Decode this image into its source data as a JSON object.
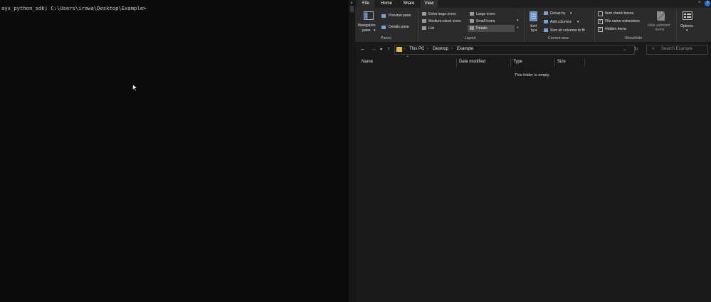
{
  "terminal": {
    "prompt": "ayx_python_sdk) C:\\Users\\irawa\\Desktop\\Example>"
  },
  "explorer": {
    "tabs": {
      "file": "File",
      "home": "Home",
      "share": "Share",
      "view": "View"
    },
    "ribbon": {
      "panes": {
        "navigation_pane": [
          "Navigation",
          "pane"
        ],
        "preview_pane": "Preview pane",
        "details_pane": "Details pane",
        "group_label": "Panes"
      },
      "layout": {
        "options": [
          "Extra large icons",
          "Large icons",
          "Medium-sized icons",
          "Small icons",
          "List",
          "Details"
        ],
        "selected": "Details",
        "group_label": "Layout"
      },
      "current_view": {
        "sort_by": [
          "Sort",
          "by"
        ],
        "group_by": "Group by",
        "add_columns": "Add columns",
        "size_all_columns": "Size all columns to fit",
        "group_label": "Current view"
      },
      "show_hide": {
        "item_check_boxes": {
          "label": "Item check boxes",
          "checked": false
        },
        "file_name_extensions": {
          "label": "File name extensions",
          "checked": true
        },
        "hidden_items": {
          "label": "Hidden items",
          "checked": true
        },
        "hide_selected_items": [
          "Hide selected",
          "items"
        ],
        "group_label": "Show/hide"
      },
      "options": "Options"
    },
    "address": {
      "breadcrumbs": [
        "This PC",
        "Desktop",
        "Example"
      ]
    },
    "search": {
      "placeholder": "Search Example"
    },
    "columns": [
      "Name",
      "Date modified",
      "Type",
      "Size"
    ],
    "empty_message": "This folder is empty."
  }
}
